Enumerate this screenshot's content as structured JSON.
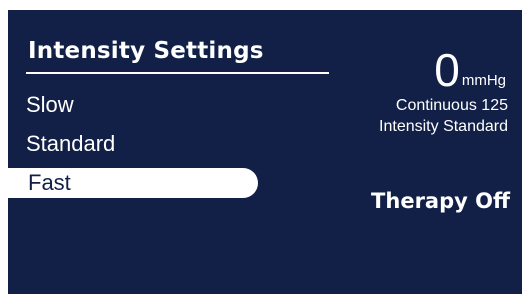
{
  "colors": {
    "screen_background": "#122047",
    "text": "#ffffff",
    "selected_background": "#ffffff",
    "selected_text": "#122047"
  },
  "menu": {
    "title": "Intensity Settings",
    "items": [
      {
        "label": "Slow",
        "selected": false
      },
      {
        "label": "Standard",
        "selected": false
      },
      {
        "label": "Fast",
        "selected": true
      }
    ]
  },
  "status": {
    "pressure_value": "0",
    "pressure_unit": "mmHg",
    "mode_line": "Continuous 125",
    "intensity_line": "Intensity Standard",
    "therapy_state": "Therapy Off"
  }
}
